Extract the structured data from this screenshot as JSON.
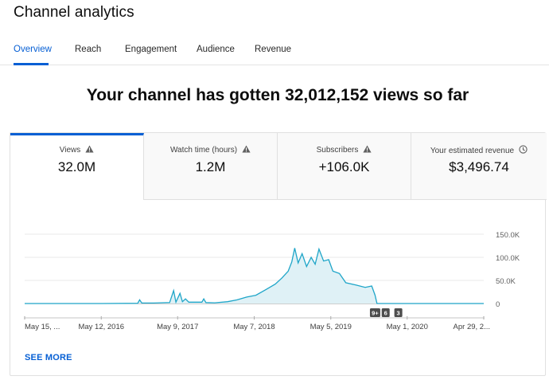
{
  "page": {
    "title": "Channel analytics"
  },
  "tabs": [
    {
      "label": "Overview",
      "active": true
    },
    {
      "label": "Reach"
    },
    {
      "label": "Engagement"
    },
    {
      "label": "Audience"
    },
    {
      "label": "Revenue"
    }
  ],
  "headline": "Your channel has gotten 32,012,152 views so far",
  "metrics": [
    {
      "label": "Views",
      "value": "32.0M",
      "icon": "warning-icon",
      "active": true
    },
    {
      "label": "Watch time (hours)",
      "value": "1.2M",
      "icon": "warning-icon"
    },
    {
      "label": "Subscribers",
      "value": "+106.0K",
      "icon": "warning-icon"
    },
    {
      "label": "Your estimated revenue",
      "value": "$3,496.74",
      "icon": "clock-icon"
    }
  ],
  "chart_data": {
    "type": "area",
    "series_color": "#1ea5c8",
    "fill_color": "#dff1f6",
    "ytick_labels": [
      "150.0K",
      "100.0K",
      "50.0K",
      "0"
    ],
    "yticks": [
      150000,
      100000,
      50000,
      0
    ],
    "ylim": [
      0,
      150000
    ],
    "xtick_labels": [
      "May 15, ...",
      "May 12, 2016",
      "May 9, 2017",
      "May 7, 2018",
      "May 5, 2019",
      "May 1, 2020",
      "Apr 29, 2..."
    ],
    "xtick_dates": [
      "2015-05-15",
      "2016-05-12",
      "2017-05-09",
      "2018-05-07",
      "2019-05-05",
      "2020-05-01",
      "2021-04-29"
    ],
    "points": [
      [
        "2015-05-15",
        0
      ],
      [
        "2016-05-01",
        0
      ],
      [
        "2016-11-01",
        500
      ],
      [
        "2016-11-10",
        8000
      ],
      [
        "2016-11-20",
        1000
      ],
      [
        "2017-01-15",
        1000
      ],
      [
        "2017-04-01",
        2000
      ],
      [
        "2017-04-20",
        28000
      ],
      [
        "2017-05-01",
        3000
      ],
      [
        "2017-05-20",
        22000
      ],
      [
        "2017-06-01",
        4000
      ],
      [
        "2017-06-15",
        10000
      ],
      [
        "2017-07-01",
        3000
      ],
      [
        "2017-09-01",
        3000
      ],
      [
        "2017-09-10",
        10000
      ],
      [
        "2017-09-20",
        2000
      ],
      [
        "2017-11-01",
        1500
      ],
      [
        "2018-01-01",
        4000
      ],
      [
        "2018-02-15",
        8000
      ],
      [
        "2018-04-01",
        14000
      ],
      [
        "2018-05-15",
        18000
      ],
      [
        "2018-07-01",
        30000
      ],
      [
        "2018-08-15",
        42000
      ],
      [
        "2018-09-15",
        55000
      ],
      [
        "2018-10-15",
        70000
      ],
      [
        "2018-11-01",
        90000
      ],
      [
        "2018-11-15",
        120000
      ],
      [
        "2018-12-01",
        88000
      ],
      [
        "2018-12-20",
        108000
      ],
      [
        "2019-01-10",
        80000
      ],
      [
        "2019-02-01",
        100000
      ],
      [
        "2019-02-20",
        85000
      ],
      [
        "2019-03-10",
        118000
      ],
      [
        "2019-04-01",
        92000
      ],
      [
        "2019-04-25",
        95000
      ],
      [
        "2019-05-15",
        70000
      ],
      [
        "2019-06-15",
        65000
      ],
      [
        "2019-07-15",
        45000
      ],
      [
        "2019-09-01",
        40000
      ],
      [
        "2019-10-15",
        35000
      ],
      [
        "2019-11-15",
        38000
      ],
      [
        "2019-12-01",
        18000
      ],
      [
        "2019-12-10",
        0
      ],
      [
        "2021-04-29",
        0
      ]
    ],
    "annotations": [
      {
        "label": "9+",
        "date": "2019-12-01"
      },
      {
        "label": "6",
        "date": "2020-01-20"
      },
      {
        "label": "3",
        "date": "2020-03-20"
      }
    ]
  },
  "see_more": "SEE MORE"
}
